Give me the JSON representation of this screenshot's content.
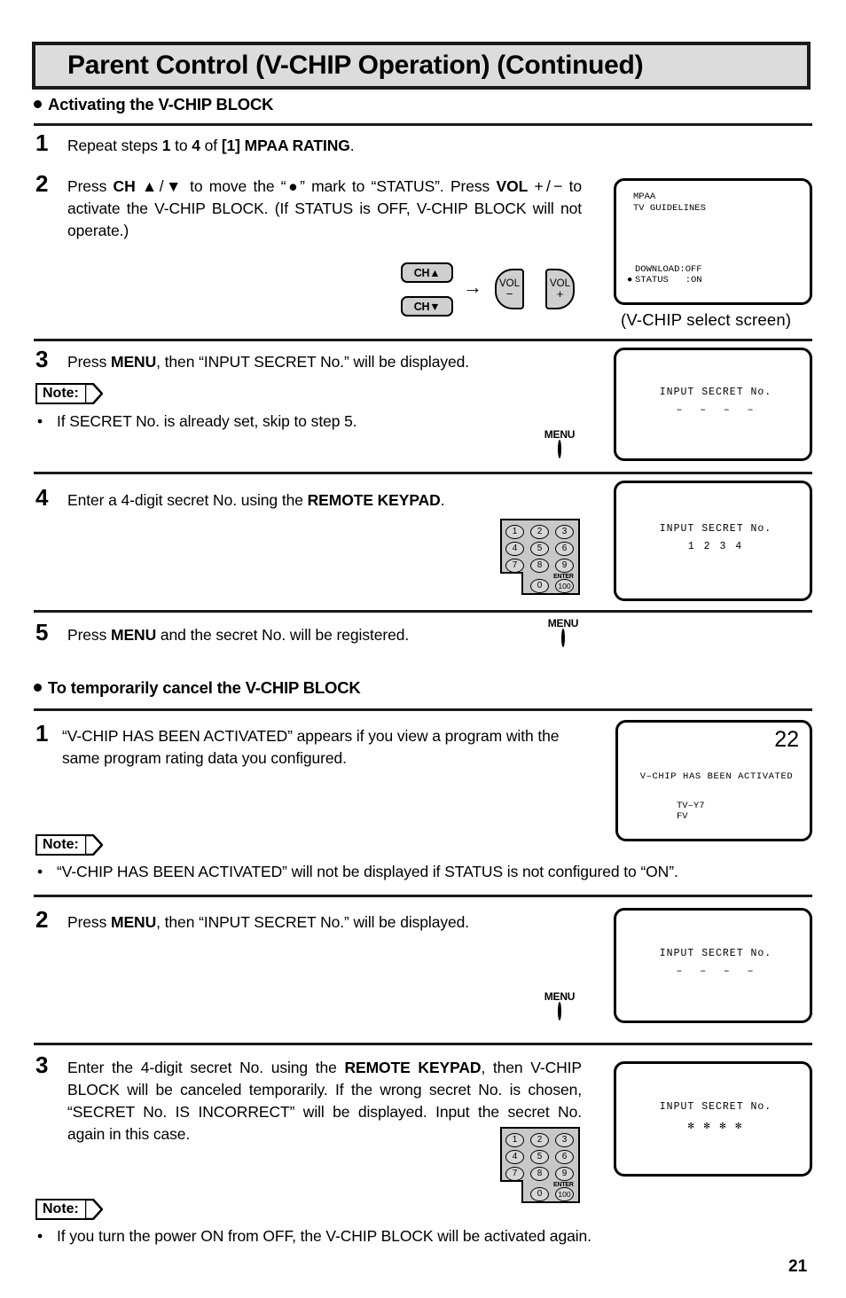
{
  "header": {
    "title": "Parent Control (V-CHIP Operation) (Continued)"
  },
  "sections": [
    {
      "heading": "Activating the V-CHIP BLOCK",
      "steps": [
        {
          "number": "1",
          "text_parts": [
            "Repeat steps ",
            "1",
            " to ",
            "4",
            " of ",
            "[1] MPAA RATING",
            "."
          ]
        },
        {
          "number": "2",
          "text_parts": [
            "Press ",
            "CH",
            " ▲/▼ to move the “●” mark to “STATUS”. Press ",
            "VOL",
            " + / − to activate the V-CHIP BLOCK. (If STATUS is OFF, V-CHIP BLOCK will not operate.)"
          ]
        },
        {
          "number": "3",
          "text_parts": [
            "Press ",
            "MENU",
            ", then “INPUT SECRET No.” will be displayed."
          ]
        },
        {
          "number": "4",
          "text_parts": [
            "Enter a 4-digit secret No. using the ",
            "REMOTE KEYPAD",
            "."
          ]
        },
        {
          "number": "5",
          "text_parts": [
            "Press ",
            "MENU",
            " and the secret No. will be registered."
          ]
        }
      ]
    },
    {
      "heading": "To temporarily cancel the V-CHIP BLOCK",
      "steps": [
        {
          "number": "1",
          "text_parts": [
            "“V-CHIP HAS BEEN ACTIVATED” appears if you view a program with the same program rating data you configured."
          ]
        },
        {
          "number": "2",
          "text_parts": [
            "Press ",
            "MENU",
            ", then “INPUT SECRET No.” will be displayed."
          ]
        },
        {
          "number": "3",
          "text_parts": [
            "Enter the 4-digit secret No. using the ",
            "REMOTE KEYPAD",
            ", then V-CHIP BLOCK will be canceled temporarily. If the wrong secret No. is chosen, “SECRET No. IS INCORRECT” will be displayed. Input the secret No. again in this case."
          ]
        }
      ]
    }
  ],
  "notes": [
    {
      "label": "Note:",
      "bullet": "•",
      "text": "If SECRET No. is already set, skip to step 5."
    },
    {
      "label": "Note:",
      "bullet": "•",
      "text": "“V-CHIP HAS BEEN ACTIVATED” will not be displayed if STATUS is not configured to “ON”."
    },
    {
      "label": "Note:",
      "bullet": "•",
      "text": "If you turn the power ON from OFF, the V-CHIP BLOCK will be activated again."
    }
  ],
  "tv_screens": {
    "vchip_select": {
      "caption": "(V-CHIP  select  screen)",
      "line1": "MPAA",
      "line2": "TV GUIDELINES",
      "line3": "DOWNLOAD:OFF",
      "line4_marker": "●",
      "line4": "STATUS   :ON"
    },
    "secret_empty_1": {
      "title": "INPUT SECRET No.",
      "value": "–  –  –  –"
    },
    "secret_filled": {
      "title": "INPUT SECRET No.",
      "value": "1 2 3 4"
    },
    "vchip_activated": {
      "channel": "22",
      "message": "V–CHIP HAS BEEN ACTIVATED",
      "rating1": "TV–Y7",
      "rating2": "FV"
    },
    "secret_empty_2": {
      "title": "INPUT SECRET No.",
      "value": "–  –  –  –"
    },
    "secret_masked": {
      "title": "INPUT SECRET No.",
      "value": "✻ ✻ ✻ ✻"
    }
  },
  "remote": {
    "ch_up": "CH▲",
    "ch_down": "CH▼",
    "arrow": "→",
    "vol_minus_label": "VOL",
    "vol_minus_sign": "−",
    "vol_plus_label": "VOL",
    "vol_plus_sign": "+",
    "menu_label": "MENU",
    "keypad": {
      "keys": [
        "1",
        "2",
        "3",
        "4",
        "5",
        "6",
        "7",
        "8",
        "9",
        "0",
        "100"
      ],
      "enter_label": "ENTER"
    }
  },
  "footer": {
    "page_number": "21"
  },
  "colors": {
    "banner_bg": "#dcdcdc",
    "ink": "#1a1a1a",
    "button_gray": "#cfcfcf",
    "keypad_gray": "#c8c8c8"
  }
}
